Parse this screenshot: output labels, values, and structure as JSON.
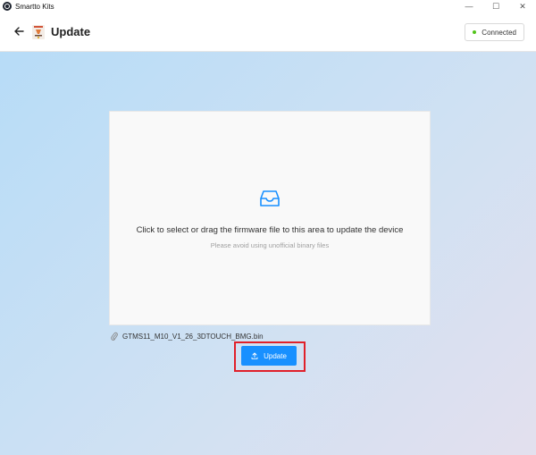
{
  "window": {
    "title": "Smartto Kits",
    "controls": {
      "minimize": "—",
      "maximize": "☐",
      "close": "✕"
    }
  },
  "header": {
    "title": "Update",
    "back_icon": "arrow-left-icon",
    "status": "Connected",
    "status_color": "#52c41a"
  },
  "dropzone": {
    "icon": "inbox-icon",
    "main_text": "Click to select or drag the firmware file to this area to update the device",
    "hint_text": "Please avoid using unofficial binary files"
  },
  "file": {
    "icon": "paperclip-icon",
    "name": "GTMS11_M10_V1_26_3DTOUCH_BMG.bin"
  },
  "update_button": {
    "icon": "upload-icon",
    "label": "Update",
    "color": "#1890ff",
    "highlight_color": "#e0202a"
  }
}
